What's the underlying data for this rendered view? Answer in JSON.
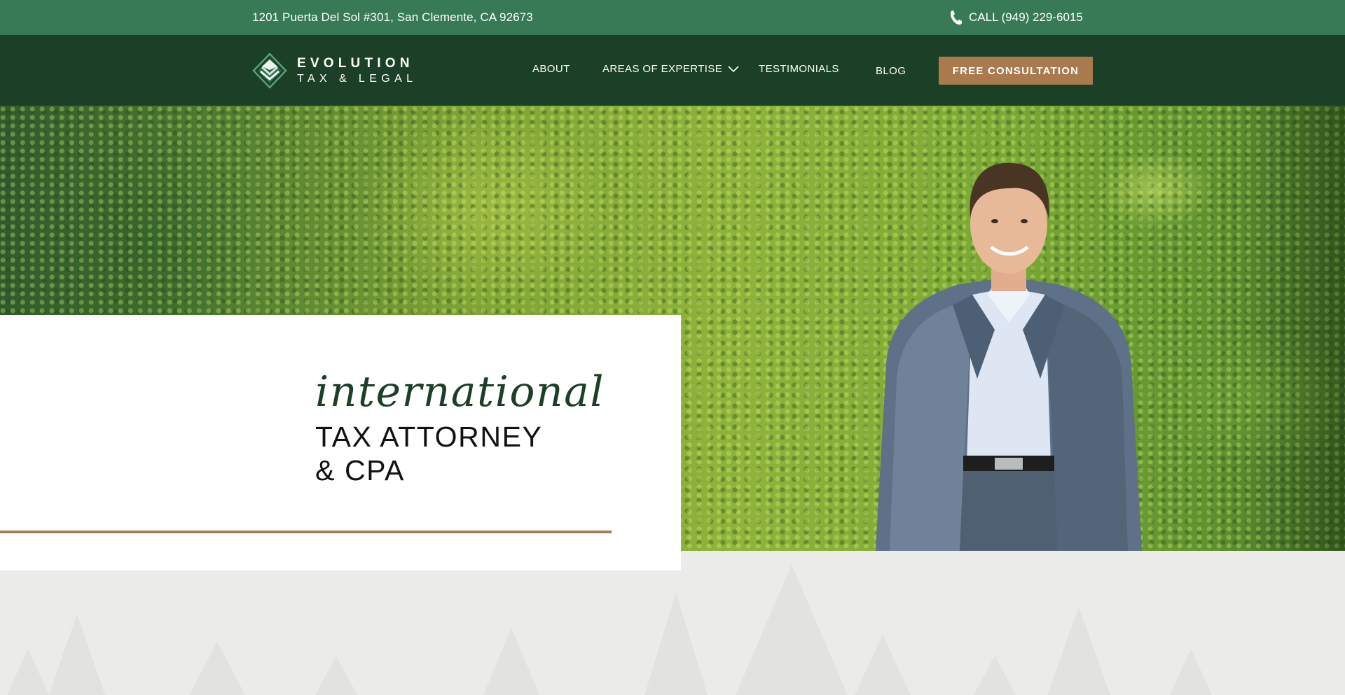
{
  "topbar": {
    "address": "1201 Puerta Del Sol #301, San Clemente, CA 92673",
    "phone_label": "CALL (949) 229-6015",
    "phone_icon": "phone-icon",
    "background_color": "#387a56"
  },
  "header": {
    "background_color": "#1c4027",
    "logo": {
      "line1": "EVOLUTION",
      "line2": "TAX & LEGAL",
      "icon": "diamond-logo-icon"
    },
    "nav": {
      "about": "ABOUT",
      "areas": "AREAS OF EXPERTISE",
      "areas_icon": "chevron-down-icon",
      "testimonials": "TESTIMONIALS",
      "blog": "BLOG"
    },
    "cta": {
      "label": "FREE CONSULTATION",
      "color": "#a87a4d"
    }
  },
  "hero": {
    "title_italic": "international",
    "title_line1": "TAX ATTORNEY",
    "title_line2": "& CPA",
    "accent_color": "#a27c53"
  }
}
